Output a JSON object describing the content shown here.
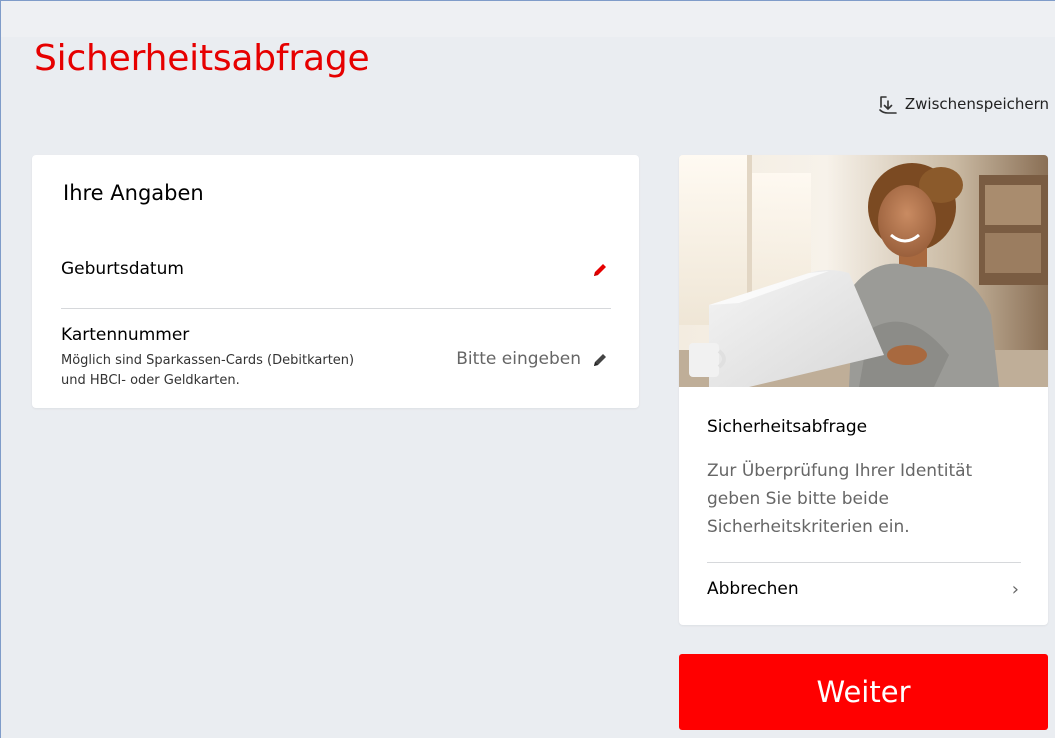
{
  "page": {
    "title": "Sicherheitsabfrage",
    "save_label": "Zwischenspeichern",
    "save_icon": "download-arrow-icon"
  },
  "details": {
    "title": "Ihre Angaben",
    "birthdate": {
      "label": "Geburtsdatum",
      "icon": "pencil-icon",
      "icon_color": "#e60000"
    },
    "card_number": {
      "label": "Kartennummer",
      "hint_line1": "Möglich sind Sparkassen-Cards (Debitkarten)",
      "hint_line2": "und HBCI- oder Geldkarten.",
      "value": "Bitte eingeben",
      "icon": "pencil-icon",
      "icon_color": "#444444"
    }
  },
  "info": {
    "image": "woman-at-laptop-photo",
    "title": "Sicherheitsabfrage",
    "text": "Zur Überprüfung Ihrer Identität geben Sie bitte beide Sicherheitskriterien ein.",
    "cancel_label": "Abbrechen",
    "cancel_icon": "chevron-right-icon"
  },
  "actions": {
    "continue_label": "Weiter"
  },
  "colors": {
    "brand_red": "#e60000",
    "button_red": "#ff0000",
    "background": "#eaedf1",
    "card": "#ffffff"
  }
}
